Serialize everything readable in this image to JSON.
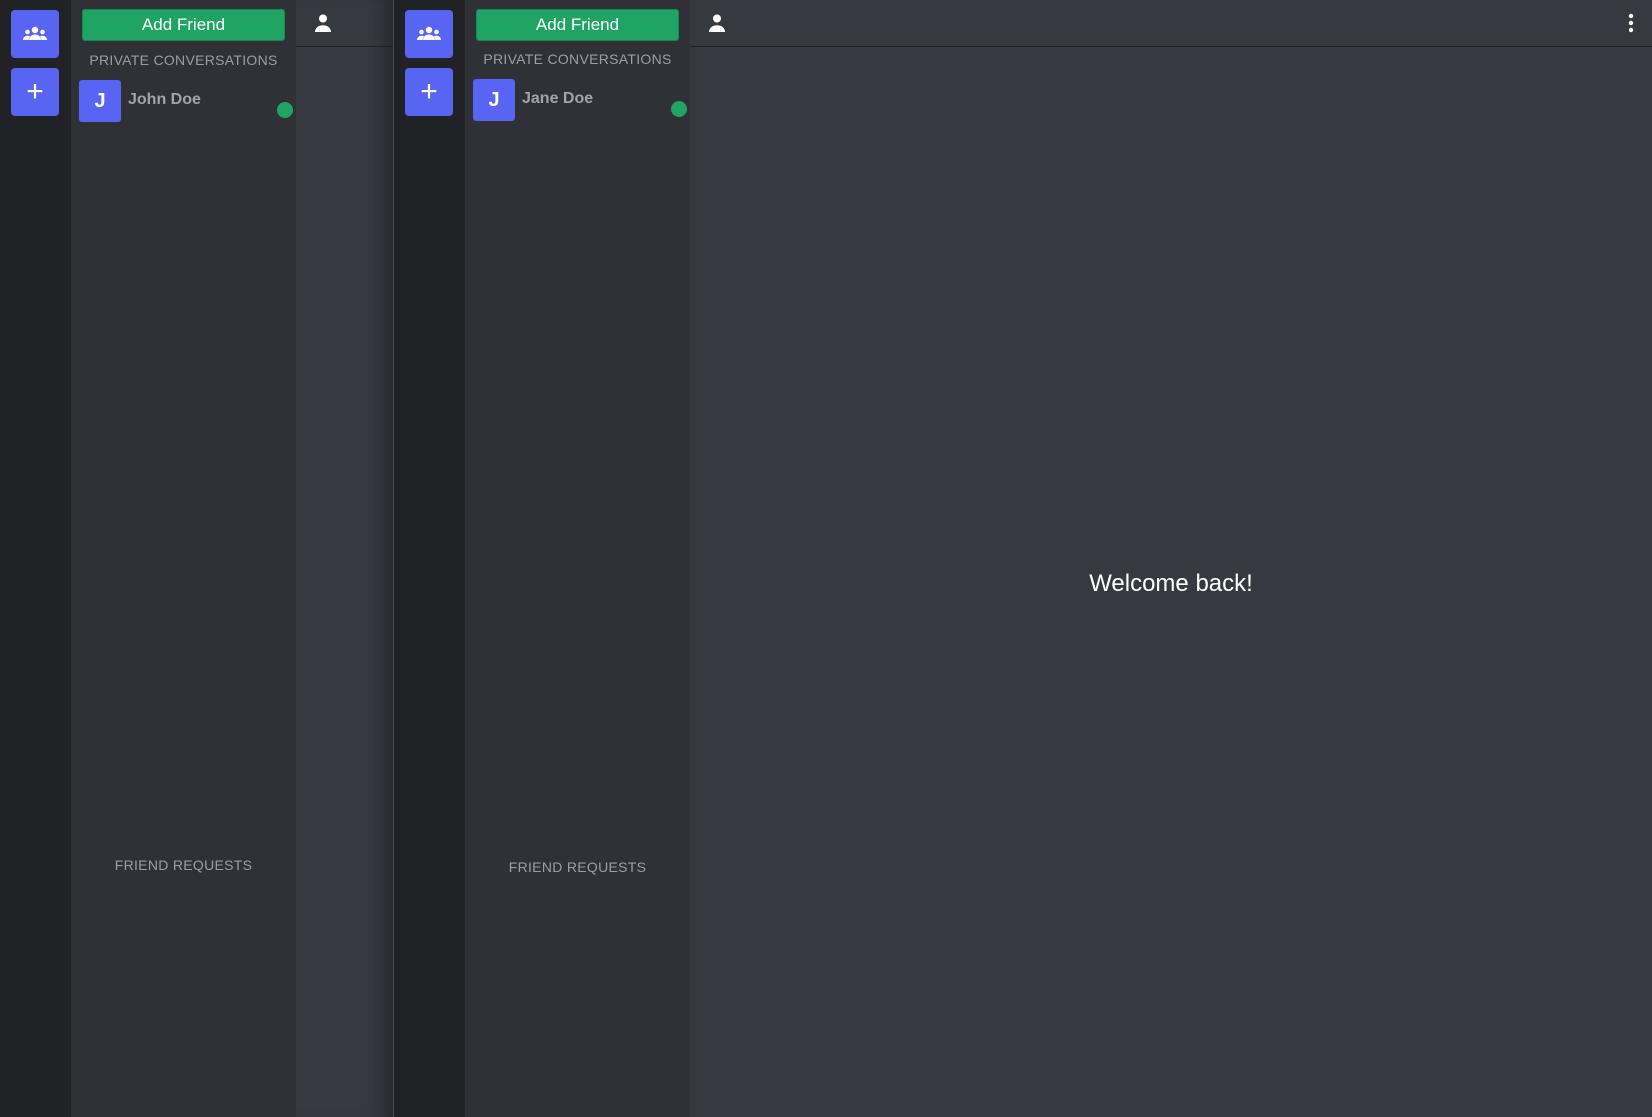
{
  "panes": {
    "left": {
      "rail": {
        "servers_icon": "group-icon",
        "add_label": "+"
      },
      "sidebar": {
        "add_friend_label": "Add Friend",
        "private_conversations_label": "PRIVATE CONVERSATIONS",
        "conversations": [
          {
            "initial": "J",
            "name": "John Doe",
            "status": "online"
          }
        ],
        "friend_requests_label": "FRIEND REQUESTS"
      },
      "topbar": {
        "user_icon": "user-icon"
      }
    },
    "right": {
      "rail": {
        "servers_icon": "group-icon",
        "add_label": "+"
      },
      "sidebar": {
        "add_friend_label": "Add Friend",
        "private_conversations_label": "PRIVATE CONVERSATIONS",
        "conversations": [
          {
            "initial": "J",
            "name": "Jane Doe",
            "status": "online"
          }
        ],
        "friend_requests_label": "FRIEND REQUESTS"
      },
      "topbar": {
        "user_icon": "user-icon",
        "menu_icon": "more-vertical-icon"
      },
      "main": {
        "welcome_text": "Welcome back!"
      }
    }
  },
  "colors": {
    "accent": "#5865f2",
    "success": "#1fa463",
    "rail_bg": "#202226",
    "sidebar_bg": "#2f3136",
    "main_bg": "#363940"
  }
}
